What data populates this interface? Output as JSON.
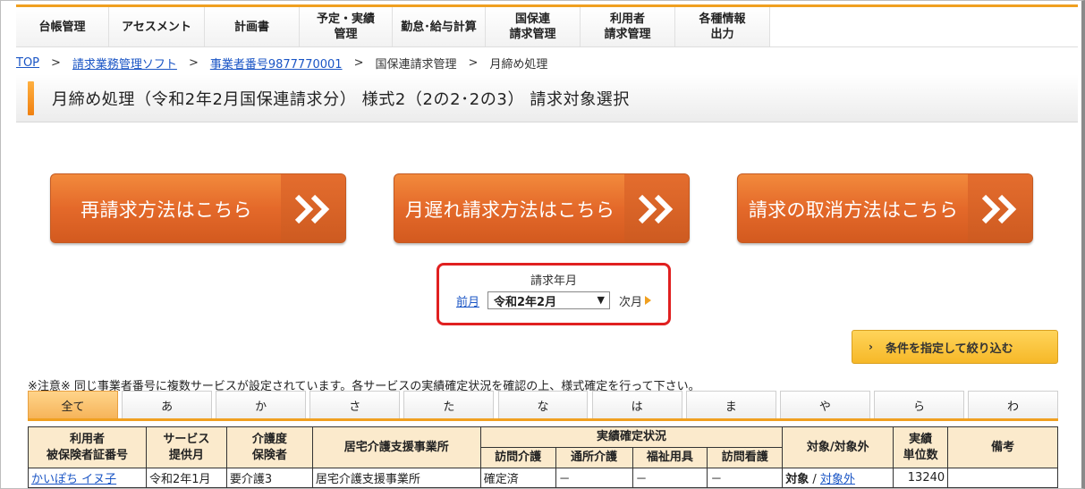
{
  "nav": {
    "items": [
      {
        "label": "台帳管理"
      },
      {
        "label": "アセスメント"
      },
      {
        "label": "計画書"
      },
      {
        "label": "予定・実績\n管理"
      },
      {
        "label": "勤怠･給与計算"
      },
      {
        "label": "国保連\n請求管理"
      },
      {
        "label": "利用者\n請求管理"
      },
      {
        "label": "各種情報\n出力"
      }
    ]
  },
  "breadcrumb": {
    "top": "TOP",
    "sep": ">",
    "soft": "請求業務管理ソフト",
    "office": "事業者番号9877770001",
    "kokuho": "国保連請求管理",
    "current": "月締め処理"
  },
  "title": "月締め処理（令和2年2月国保連請求分） 様式2（2の2･2の3） 請求対象選択",
  "buttons": {
    "reclaim": "再請求方法はこちら",
    "late": "月遅れ請求方法はこちら",
    "cancel": "請求の取消方法はこちら"
  },
  "month": {
    "label": "請求年月",
    "prev": "前月",
    "selected": "令和2年2月",
    "next": "次月"
  },
  "filter_label": "条件を指定して絞り込む",
  "notice": "※注意※ 同じ事業者番号に複数サービスが設定されています。各サービスの実績確定状況を確認の上、様式確定を行って下さい。",
  "tabs": [
    "全て",
    "あ",
    "か",
    "さ",
    "た",
    "な",
    "は",
    "ま",
    "や",
    "ら",
    "わ"
  ],
  "table": {
    "h_user": "利用者",
    "h_user2": "被保険者証番号",
    "h_month": "サービス",
    "h_month2": "提供月",
    "h_care": "介護度",
    "h_care2": "保険者",
    "h_office": "居宅介護支援事業所",
    "h_status": "実績確定状況",
    "h_s1": "訪問介護",
    "h_s2": "通所介護",
    "h_s3": "福祉用具",
    "h_s4": "訪問看護",
    "h_target": "対象/対象外",
    "h_units": "実績",
    "h_units2": "単位数",
    "h_note": "備考",
    "row": {
      "user": "かいぽち イヌ子",
      "month": "令和2年1月",
      "care": "要介護3",
      "office": "居宅介護支援事業所",
      "s1": "確定済",
      "s2": "－",
      "s3": "－",
      "s4": "－",
      "target": "対象",
      "slash": "/",
      "nontarget": "対象外",
      "units": "13240",
      "note": ""
    }
  },
  "colors": {
    "accent": "#f0a020",
    "button_orange": "#e4692a",
    "highlight_red": "#e02020",
    "link_blue": "#1a55c5"
  }
}
